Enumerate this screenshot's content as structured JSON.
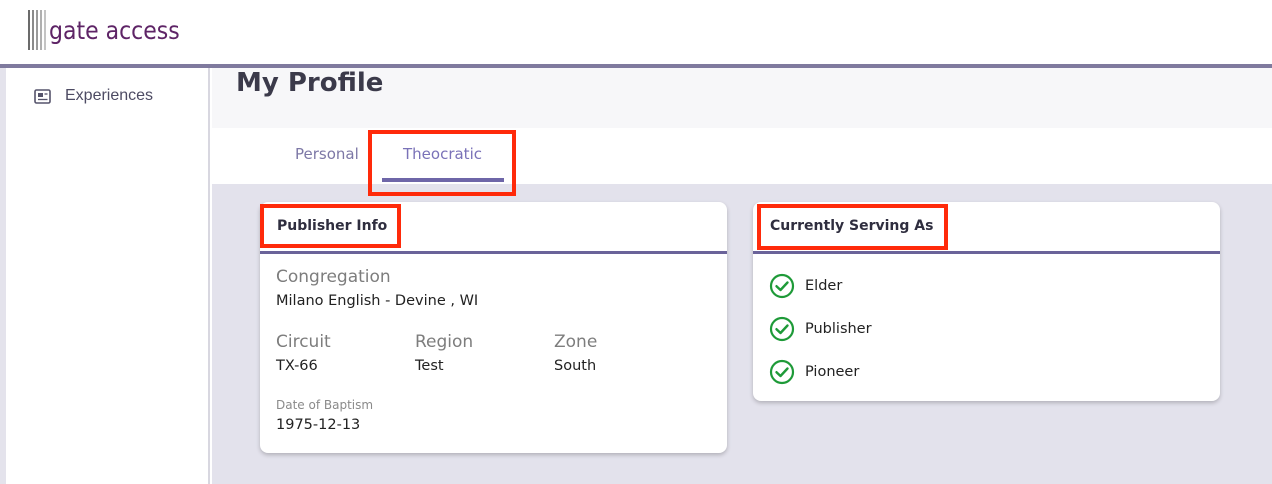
{
  "header": {
    "logo_text": "gate access",
    "accent_color": "#5e2466"
  },
  "sidebar": {
    "items": [
      {
        "label": "Experiences",
        "icon": "newspaper-icon"
      }
    ]
  },
  "main": {
    "title": "My Profile",
    "tabs": [
      {
        "label": "Personal",
        "selected": false
      },
      {
        "label": "Theocratic",
        "selected": true
      }
    ]
  },
  "publisher_info": {
    "title": "Publisher Info",
    "congregation_label": "Congregation",
    "congregation_value": "Milano English - Devine , WI",
    "circuit_label": "Circuit",
    "circuit_value": "TX-66",
    "region_label": "Region",
    "region_value": "Test",
    "zone_label": "Zone",
    "zone_value": "South",
    "baptism_label": "Date of Baptism",
    "baptism_value": "1975-12-13"
  },
  "serving": {
    "title": "Currently Serving As",
    "items": [
      {
        "label": "Elder",
        "icon": "check-circle-icon"
      },
      {
        "label": "Publisher",
        "icon": "check-circle-icon"
      },
      {
        "label": "Pioneer",
        "icon": "check-circle-icon"
      }
    ],
    "check_color": "#1e9a38"
  },
  "colors": {
    "highlight": "#ff2a0a",
    "tab_accent": "#6e66a8",
    "main_background": "#e3e2ec"
  }
}
